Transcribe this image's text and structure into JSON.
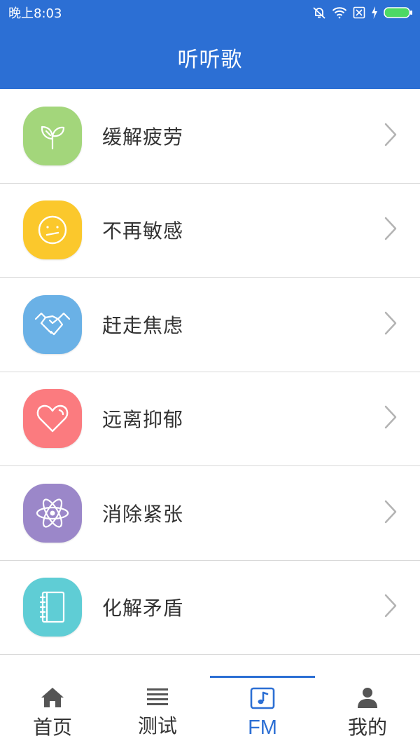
{
  "status_bar": {
    "time": "晚上8:03",
    "icons": [
      "mute-icon",
      "wifi-icon",
      "sim-off-icon",
      "charging-icon",
      "battery-icon"
    ],
    "battery_color": "#4cd964"
  },
  "app_bar": {
    "title": "听听歌",
    "background": "#2c6fd4"
  },
  "list": {
    "items": [
      {
        "label": "缓解疲劳",
        "icon": "leaf-icon",
        "color": "#a3d67b"
      },
      {
        "label": "不再敏感",
        "icon": "neutral-face-icon",
        "color": "#fbc82c"
      },
      {
        "label": "赶走焦虑",
        "icon": "handshake-icon",
        "color": "#6ab1e6"
      },
      {
        "label": "远离抑郁",
        "icon": "heart-icon",
        "color": "#fb7b7f"
      },
      {
        "label": "消除紧张",
        "icon": "atom-icon",
        "color": "#9b87c9"
      },
      {
        "label": "化解矛盾",
        "icon": "notebook-icon",
        "color": "#5fcdd5"
      }
    ]
  },
  "tab_bar": {
    "tabs": [
      {
        "label": "首页",
        "icon": "home-icon"
      },
      {
        "label": "测试",
        "icon": "list-icon"
      },
      {
        "label": "FM",
        "icon": "music-note-icon",
        "active": true
      },
      {
        "label": "我的",
        "icon": "person-icon"
      }
    ],
    "active_color": "#2c6fd4"
  }
}
